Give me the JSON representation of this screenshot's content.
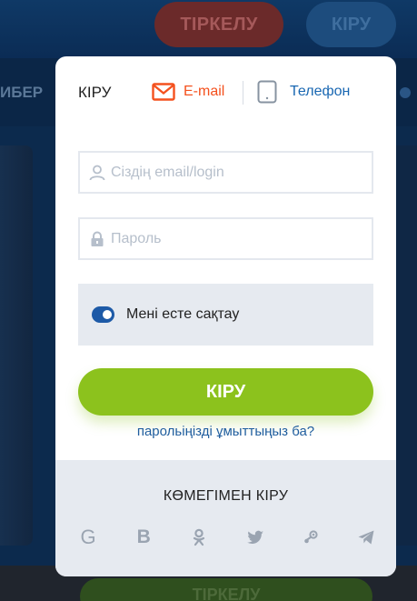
{
  "background": {
    "register_label": "ТІРКЕЛУ",
    "login_label": "КІРУ",
    "nav_text": "ИБЕР",
    "footer_register_label": "ТІРКЕЛУ"
  },
  "modal": {
    "title": "КІРУ",
    "tabs": {
      "email": "E-mail",
      "phone": "Телефон"
    },
    "email_field": {
      "placeholder": "Сіздің email/login",
      "value": ""
    },
    "password_field": {
      "placeholder": "Пароль",
      "value": ""
    },
    "remember_me": {
      "label": "Мені есте сақтау",
      "checked": true
    },
    "login_button": "КІРУ",
    "forgot_link": "парольіңізді ұмыттыңыз ба?",
    "social": {
      "title": "КӨМЕГІМЕН КІРУ",
      "g_glyph": "G",
      "b_glyph": "B"
    }
  },
  "colors": {
    "accent_orange": "#f4511e",
    "link_blue": "#1967b2",
    "button_green": "#8cc21d",
    "toggle_blue": "#1d5aa7",
    "panel_grey": "#e6eaf0"
  },
  "icons": [
    "envelope-icon",
    "phone-icon",
    "user-icon",
    "lock-icon",
    "google-icon",
    "vk-icon",
    "odnoklassniki-icon",
    "twitter-icon",
    "steam-icon",
    "telegram-icon"
  ]
}
